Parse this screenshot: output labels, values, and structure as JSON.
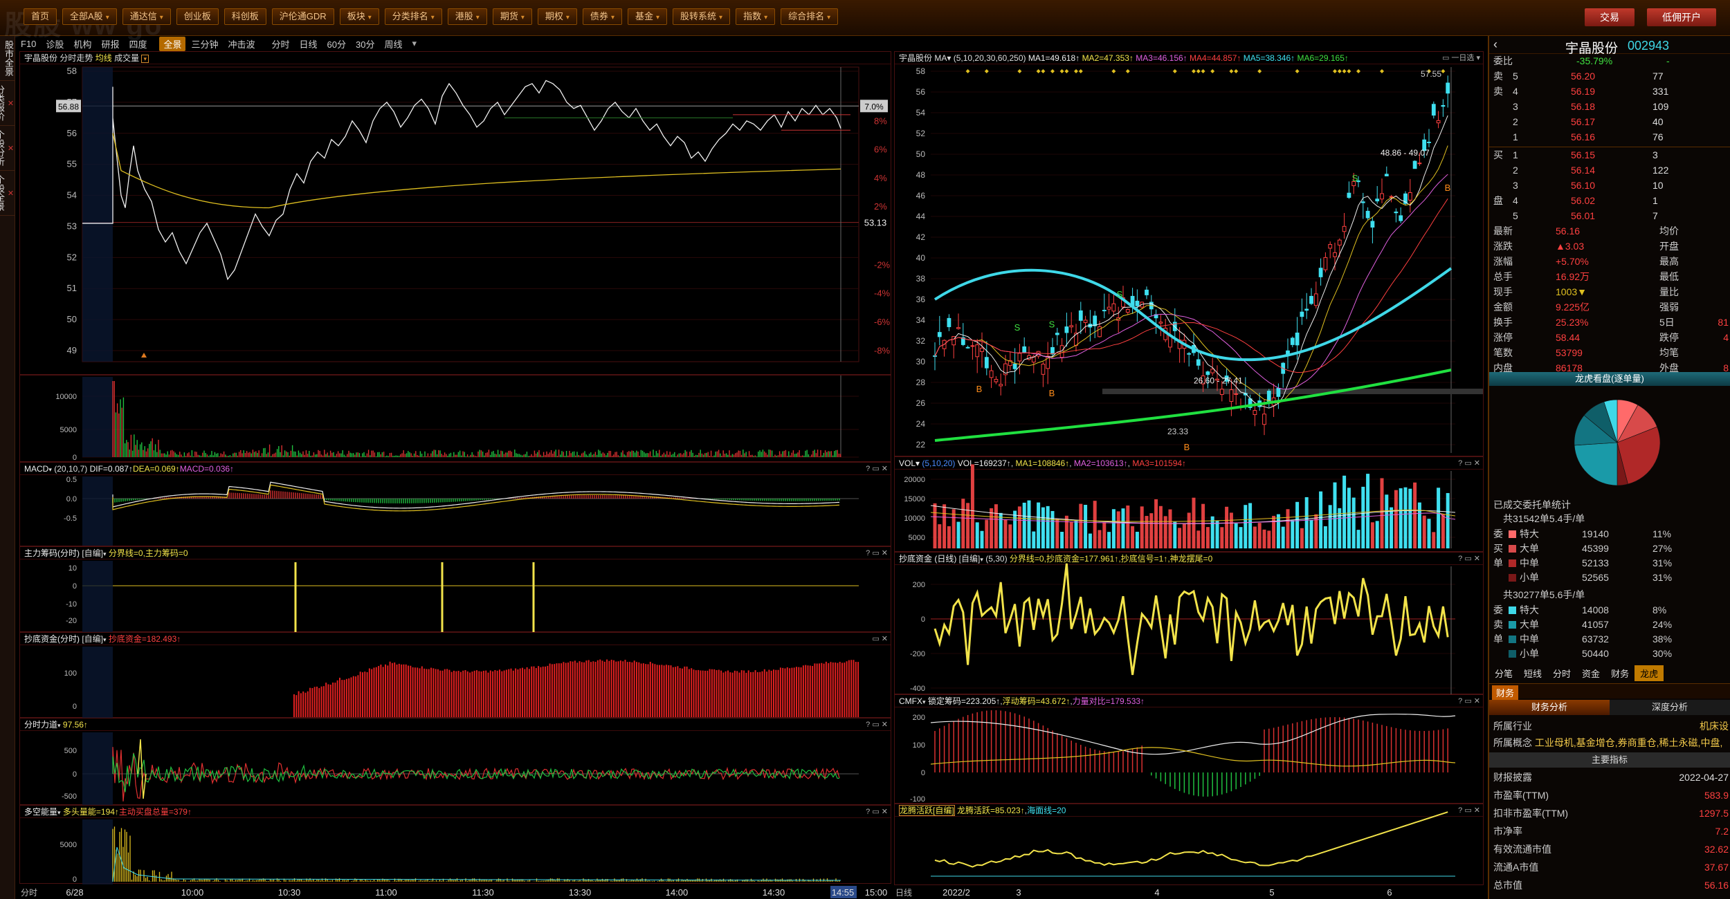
{
  "window": {
    "title_strip": "",
    "watermark": "股股 ww   go"
  },
  "menu": [
    {
      "label": "首页",
      "caret": false
    },
    {
      "label": "全部A股",
      "caret": true
    },
    {
      "label": "通达信",
      "caret": true
    },
    {
      "label": "创业板",
      "caret": false
    },
    {
      "label": "科创板",
      "caret": false
    },
    {
      "label": "沪伦通GDR",
      "caret": false
    },
    {
      "label": "板块",
      "caret": true
    },
    {
      "label": "分类排名",
      "caret": true
    },
    {
      "label": "港股",
      "caret": true
    },
    {
      "label": "期货",
      "caret": true
    },
    {
      "label": "期权",
      "caret": true
    },
    {
      "label": "债券",
      "caret": true
    },
    {
      "label": "基金",
      "caret": true
    },
    {
      "label": "股转系统",
      "caret": true
    },
    {
      "label": "指数",
      "caret": true
    },
    {
      "label": "综合排名",
      "caret": true
    }
  ],
  "top_right": {
    "trade": "交易",
    "margin": "低佣开户"
  },
  "left_nav": [
    {
      "label": "股市全景",
      "closable": false
    },
    {
      "label": "分类报价",
      "closable": true
    },
    {
      "label": "个股分析",
      "closable": true
    },
    {
      "label": "个股全景",
      "closable": true
    }
  ],
  "toolbar": {
    "left": [
      "F10",
      "诊股",
      "机构",
      "研报",
      "四度"
    ],
    "tabs": [
      "全景",
      "三分钟",
      "冲击波",
      "分时",
      "日线",
      "60分",
      "30分",
      "周线"
    ],
    "active_tab": "全景"
  },
  "intraday": {
    "header": {
      "stock": "宇晶股份",
      "mode": "分时走势",
      "line": "均线",
      "volume": "成交量"
    },
    "left_axis": [
      "58",
      "57",
      "56",
      "55",
      "54",
      "53",
      "52",
      "51",
      "50",
      "49"
    ],
    "right_axis": [
      "8%",
      "6%",
      "4%",
      "2%",
      "",
      "-2%",
      "-4%",
      "-6%",
      "-8%"
    ],
    "price_tag": "56.88",
    "pct_tag": "7.0%",
    "prev_close_label": "53.13",
    "vol_axis": [
      "10000",
      "5000",
      "0"
    ],
    "x_labels": [
      "6/28",
      "10:00",
      "10:30",
      "11:00",
      "11:30",
      "13:30",
      "14:00",
      "14:30",
      "14:55",
      "15:00"
    ],
    "x_left_label": "分时",
    "colors": {
      "price": "#f0f0f0",
      "avg": "#e0c020"
    }
  },
  "macd_intraday": {
    "name": "MACD",
    "params": "(20,10,7)",
    "dif": "DIF=0.087↑",
    "dea": "DEA=0.069↑",
    "macd": "MACD=0.036↑",
    "axis": [
      "0.5",
      "0.0",
      "-0.5"
    ]
  },
  "chip": {
    "name": "主力筹码(分时)",
    "note": "[自编]",
    "text": "分界线=0,主力筹码=0",
    "axis": [
      "10",
      "0",
      "-10",
      "-20"
    ]
  },
  "dipfund_intraday": {
    "name": "抄底资金(分时)",
    "note": "[自编]",
    "text": "抄底资金=182.493↑",
    "axis": [
      "100",
      "0"
    ]
  },
  "force": {
    "name": "分时力道",
    "value": "97.56↑",
    "axis": [
      "500",
      "0",
      "-500"
    ]
  },
  "bullbear": {
    "name": "多空能量",
    "bull": "多头量能=194↑",
    "flow": "主动买盘总量=379↑",
    "axis": [
      "5000",
      "0"
    ]
  },
  "kline": {
    "header": {
      "stock": "宇晶股份",
      "ma_params": "(5,10,20,30,60,250)",
      "ma1": "MA1=49.618↑",
      "ma2": "MA2=47.353↑",
      "ma3": "MA3=46.156↑",
      "ma4": "MA4=44.857↑",
      "ma5": "MA5=38.346↑",
      "ma6": "MA6=29.165↑"
    },
    "axis": [
      "58",
      "56",
      "54",
      "52",
      "50",
      "48",
      "46",
      "44",
      "42",
      "40",
      "38",
      "36",
      "34",
      "32",
      "30",
      "28",
      "26",
      "24",
      "22"
    ],
    "annot": {
      "top": "57.55",
      "range1": "48.86 - 49.07",
      "range2": "26.60 - 27.41",
      "low": "23.33",
      "s": "S",
      "b": "B"
    },
    "x_labels": [
      "2022/2",
      "3",
      "4",
      "5",
      "6"
    ],
    "x_left_label": "日线"
  },
  "vol_daily": {
    "name": "VOL",
    "params": "(5,10,20)",
    "vol": "VOL=169237↑",
    "ma1": "MA1=108846↑",
    "ma2": "MA2=103613↑",
    "ma3": "MA3=101594↑",
    "axis": [
      "20000",
      "15000",
      "10000",
      "5000"
    ]
  },
  "dipfund_daily": {
    "name": "抄底资金 (日线)",
    "note": "[自编]",
    "params": "(5,30)",
    "text": "分界线=0,抄底资金=177.961↑,抄底信号=1↑,神龙摆尾=0",
    "axis": [
      "200",
      "0",
      "-200",
      "-400"
    ]
  },
  "cmfx": {
    "name": "CMFX",
    "lock": "锁定筹码=223.205↑",
    "float": "浮动筹码=43.672↑",
    "ratio": "力量对比=179.533↑",
    "axis": [
      "200",
      "100",
      "0",
      "-100"
    ]
  },
  "dragon": {
    "name": "龙腾活跃[自编]",
    "value": "龙腾活跃=85.023↑",
    "line": "海面线=20"
  },
  "quote": {
    "name": "宇晶股份",
    "code": "002943",
    "weibi_label": "委比",
    "weibi": "-35.79%",
    "weicha": "-",
    "asks": [
      [
        "卖",
        "5",
        "56.20",
        "77"
      ],
      [
        "卖",
        "4",
        "56.19",
        "331"
      ],
      [
        "",
        "3",
        "56.18",
        "109"
      ],
      [
        "",
        "2",
        "56.17",
        "40"
      ],
      [
        "",
        "1",
        "56.16",
        "76"
      ]
    ],
    "bids": [
      [
        "买",
        "1",
        "56.15",
        "3"
      ],
      [
        "",
        "2",
        "56.14",
        "122"
      ],
      [
        "",
        "3",
        "56.10",
        "10"
      ],
      [
        "盘",
        "4",
        "56.02",
        "1"
      ],
      [
        "",
        "5",
        "56.01",
        "7"
      ]
    ],
    "ask_side_label": "卖盘",
    "bid_side_label": "买盘",
    "stats": [
      [
        "最新",
        "56.16",
        "均价",
        ""
      ],
      [
        "涨跌",
        "▲3.03",
        "开盘",
        ""
      ],
      [
        "涨幅",
        "+5.70%",
        "最高",
        ""
      ],
      [
        "总手",
        "16.92万",
        "最低",
        ""
      ],
      [
        "现手",
        "1003▼",
        "量比",
        ""
      ],
      [
        "金额",
        "9.225亿",
        "强弱",
        ""
      ],
      [
        "换手",
        "25.23%",
        "5日",
        "81"
      ],
      [
        "涨停",
        "58.44",
        "跌停",
        "4"
      ],
      [
        "笔数",
        "53799",
        "均笔",
        ""
      ],
      [
        "内盘",
        "86178",
        "外盘",
        "8"
      ]
    ]
  },
  "flow": {
    "title": "龙虎看盘(逐单量)",
    "slices": [
      {
        "pct": 8,
        "color": "#ff6a6a"
      },
      {
        "pct": 11,
        "color": "#d84a4a"
      },
      {
        "pct": 27,
        "color": "#b02828"
      },
      {
        "pct": 4,
        "color": "#7a1818"
      },
      {
        "pct": 24,
        "color": "#1a9aa8"
      },
      {
        "pct": 12,
        "color": "#137582"
      },
      {
        "pct": 9,
        "color": "#0f5e68"
      },
      {
        "pct": 5,
        "color": "#3fd8e8"
      }
    ],
    "stat_title": "已成交委托单统计",
    "buy_total": "共31542单5.4手/单",
    "buy": [
      [
        "委",
        "特大",
        "19140",
        "11%"
      ],
      [
        "买",
        "大单",
        "45399",
        "27%"
      ],
      [
        "单",
        "中单",
        "52133",
        "31%"
      ],
      [
        "",
        "小单",
        "52565",
        "31%"
      ]
    ],
    "sell_total": "共30277单5.6手/单",
    "sell": [
      [
        "委",
        "特大",
        "14008",
        "8%"
      ],
      [
        "卖",
        "大单",
        "41057",
        "24%"
      ],
      [
        "单",
        "中单",
        "63732",
        "38%"
      ],
      [
        "",
        "小单",
        "50440",
        "30%"
      ]
    ],
    "tabs": [
      "分笔",
      "短线",
      "分时",
      "资金",
      "财务",
      "龙虎"
    ],
    "active": "龙虎"
  },
  "finance": {
    "tab": "财务",
    "sub_tabs": [
      "财务分析",
      "深度分析"
    ],
    "industry_label": "所属行业",
    "industry": "机床设",
    "concept_label": "所属概念",
    "concept": "工业母机,基金增仓,券商重仓,稀土永磁,中盘,",
    "key_title": "主要指标",
    "rows": [
      [
        "财报披露",
        "2022-04-27"
      ],
      [
        "市盈率(TTM)",
        "583.9"
      ],
      [
        "扣非市盈率(TTM)",
        "1297.5"
      ],
      [
        "市净率",
        "7.2"
      ],
      [
        "有效流通市值",
        "32.62"
      ],
      [
        "流通A市值",
        "37.67"
      ],
      [
        "总市值",
        "56.16"
      ]
    ]
  }
}
